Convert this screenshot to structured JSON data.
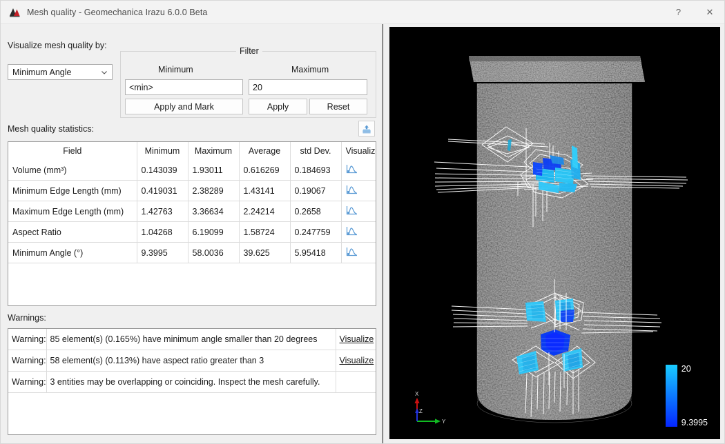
{
  "window": {
    "title": "Mesh quality - Geomechanica Irazu 6.0.0 Beta",
    "logo_icon": "geomechanica-logo-icon",
    "help_label": "?",
    "close_label": "✕"
  },
  "controls": {
    "visualize_label": "Visualize mesh quality by:",
    "quality_selected": "Minimum Angle",
    "chevron_icon": "chevron-down-icon"
  },
  "filter": {
    "legend": "Filter",
    "minimum_header": "Minimum",
    "maximum_header": "Maximum",
    "minimum_value": "<min>",
    "maximum_value": "20",
    "apply_and_mark_label": "Apply and Mark",
    "apply_label": "Apply",
    "reset_label": "Reset"
  },
  "statistics": {
    "label": "Mesh quality statistics:",
    "export_icon": "export-icon",
    "columns": [
      "Field",
      "Minimum",
      "Maximum",
      "Average",
      "std Dev.",
      "Visualize"
    ],
    "rows": [
      {
        "field": "Volume (mm³)",
        "minimum": "0.143039",
        "maximum": "1.93011",
        "average": "0.616269",
        "std_dev": "0.184693",
        "visualize_icon": "histogram-icon"
      },
      {
        "field": "Minimum Edge Length (mm)",
        "minimum": "0.419031",
        "maximum": "2.38289",
        "average": "1.43141",
        "std_dev": "0.19067",
        "visualize_icon": "histogram-icon"
      },
      {
        "field": "Maximum Edge Length (mm)",
        "minimum": "1.42763",
        "maximum": "3.36634",
        "average": "2.24214",
        "std_dev": "0.2658",
        "visualize_icon": "histogram-icon"
      },
      {
        "field": "Aspect Ratio",
        "minimum": "1.04268",
        "maximum": "6.19099",
        "average": "1.58724",
        "std_dev": "0.247759",
        "visualize_icon": "histogram-icon"
      },
      {
        "field": "Minimum Angle (°)",
        "minimum": "9.3995",
        "maximum": "58.0036",
        "average": "39.625",
        "std_dev": "5.95418",
        "visualize_icon": "histogram-icon"
      }
    ]
  },
  "warnings": {
    "label": "Warnings:",
    "rows": [
      {
        "tag": "Warning:",
        "message": "85 element(s) (0.165%) have minimum angle smaller than 20 degrees",
        "action": "Visualize"
      },
      {
        "tag": "Warning:",
        "message": "58 element(s) (0.113%) have aspect ratio greater than 3",
        "action": "Visualize"
      },
      {
        "tag": "Warning:",
        "message": "3 entities may be overlapping or coinciding. Inspect the mesh carefully.",
        "action": ""
      }
    ]
  },
  "viewport": {
    "background_color": "#000000",
    "colorbar": {
      "max_label": "20",
      "min_label": "9.3995",
      "top_color": "#19ccff",
      "bottom_color": "#0526ff"
    },
    "axis_triad": {
      "x_label": "X",
      "y_label": "Y",
      "z_label": "Z",
      "x_color": "#cc1111",
      "y_color": "#11bb22",
      "z_color": "#2233dd"
    }
  }
}
